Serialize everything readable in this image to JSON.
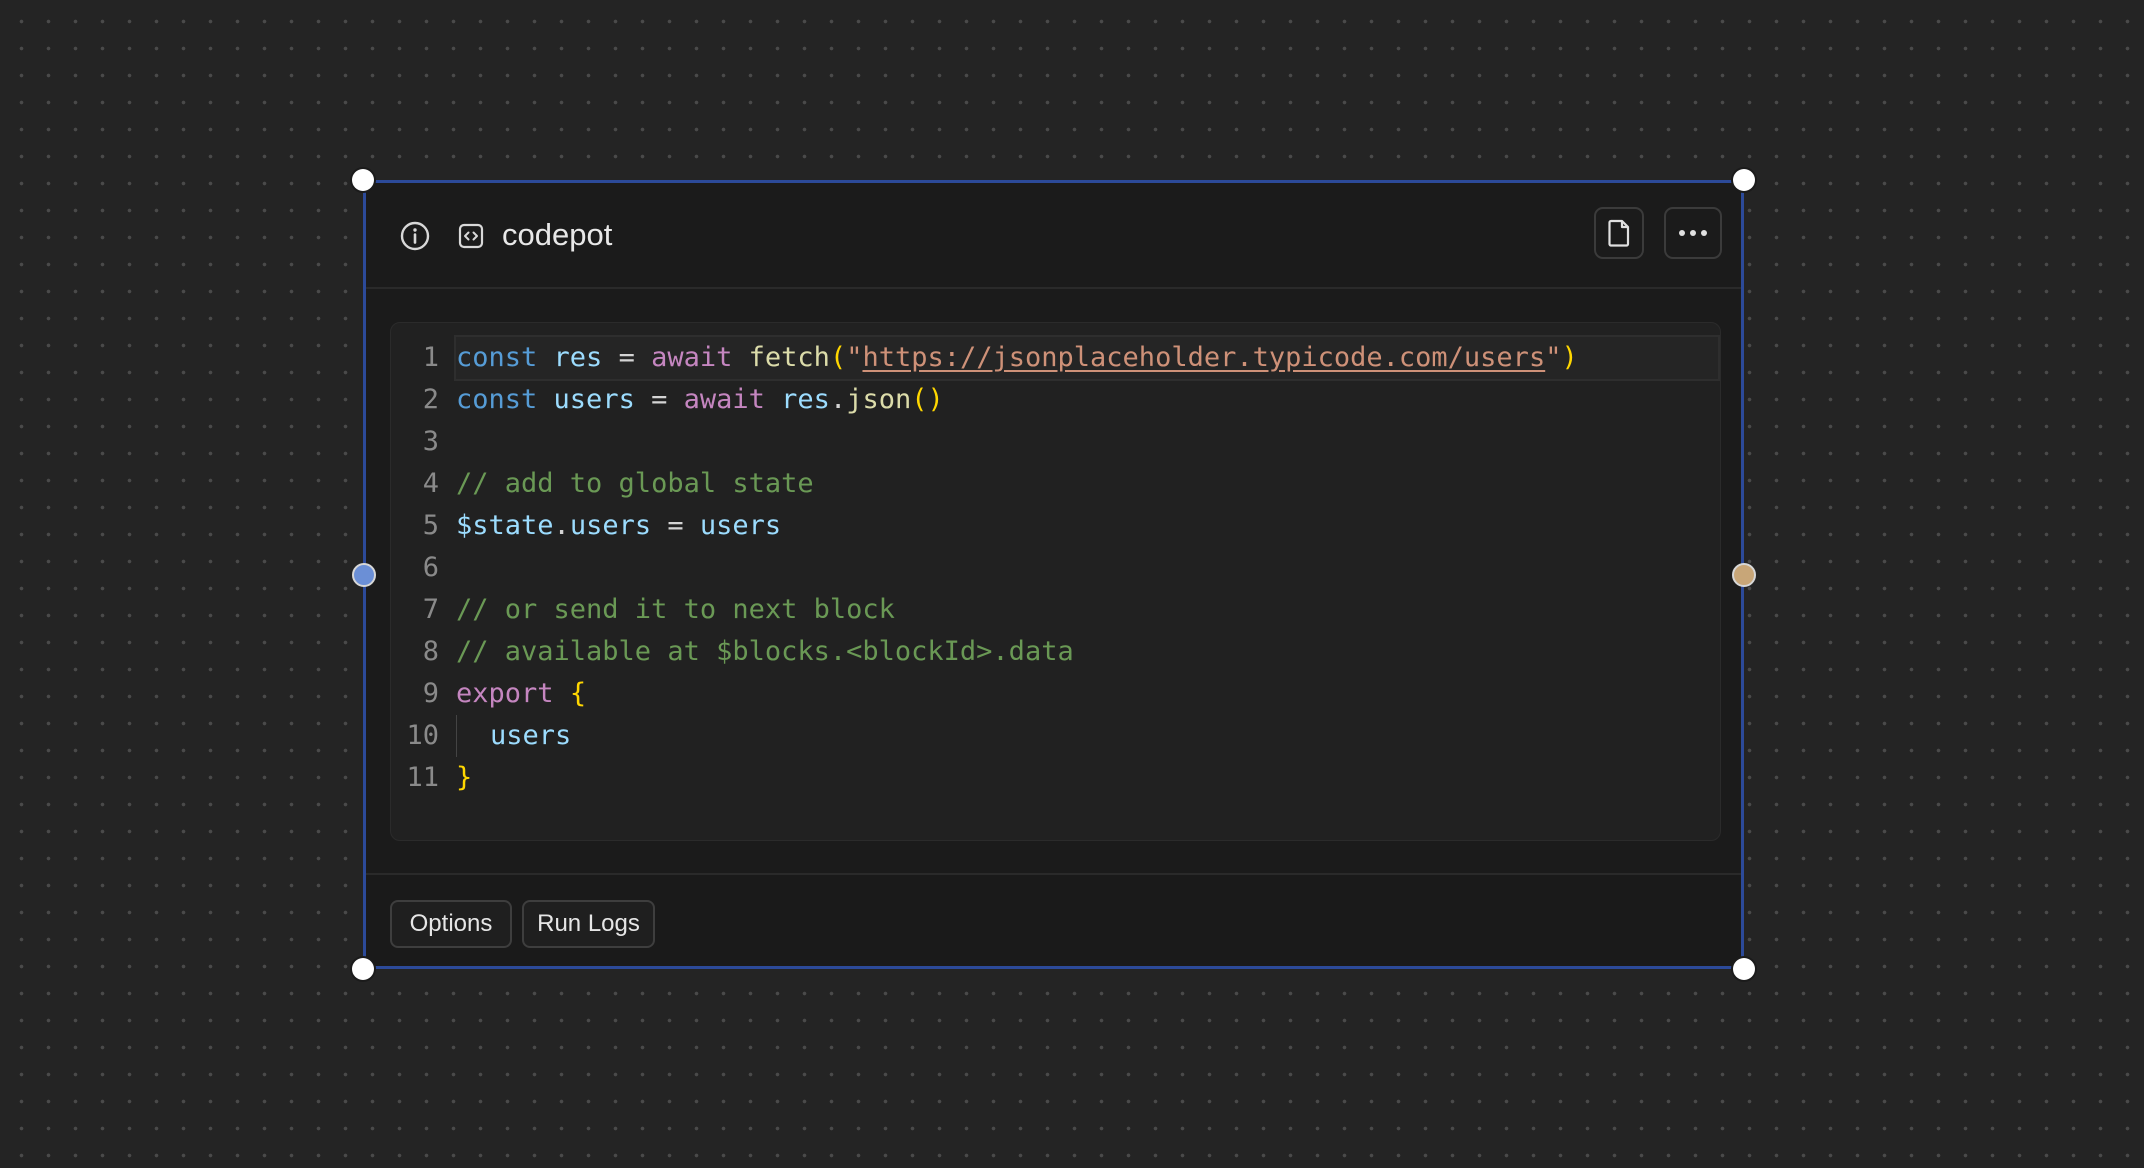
{
  "node": {
    "title": "codepot",
    "icons": {
      "info": "info-circle-icon",
      "code": "code-file-icon",
      "file": "file-icon",
      "more": "more-horizontal-icon",
      "edit": "edit-icon"
    },
    "colors": {
      "selection_border": "#2c4a99",
      "input_port": "#6b8fd6",
      "output_port": "#c8a678"
    }
  },
  "editor": {
    "line_numbers": [
      "1",
      "2",
      "3",
      "4",
      "5",
      "6",
      "7",
      "8",
      "9",
      "10",
      "11"
    ],
    "lines": [
      [
        {
          "t": "const",
          "c": "kw"
        },
        {
          "t": " "
        },
        {
          "t": "res",
          "c": "var"
        },
        {
          "t": " = "
        },
        {
          "t": "await",
          "c": "kw2"
        },
        {
          "t": " "
        },
        {
          "t": "fetch",
          "c": "fn"
        },
        {
          "t": "(",
          "c": "br"
        },
        {
          "t": "\"",
          "c": "str"
        },
        {
          "t": "https://jsonplaceholder.typicode.com/users",
          "c": "url"
        },
        {
          "t": "\"",
          "c": "str"
        },
        {
          "t": ")",
          "c": "br"
        }
      ],
      [
        {
          "t": "const",
          "c": "kw"
        },
        {
          "t": " "
        },
        {
          "t": "users",
          "c": "var"
        },
        {
          "t": " = "
        },
        {
          "t": "await",
          "c": "kw2"
        },
        {
          "t": " "
        },
        {
          "t": "res",
          "c": "var"
        },
        {
          "t": "."
        },
        {
          "t": "json",
          "c": "fn"
        },
        {
          "t": "()",
          "c": "br"
        }
      ],
      [],
      [
        {
          "t": "// add to global state",
          "c": "com"
        }
      ],
      [
        {
          "t": "$state",
          "c": "var"
        },
        {
          "t": "."
        },
        {
          "t": "users",
          "c": "var"
        },
        {
          "t": " = "
        },
        {
          "t": "users",
          "c": "var"
        }
      ],
      [],
      [
        {
          "t": "// or send it to next block",
          "c": "com"
        }
      ],
      [
        {
          "t": "// available at $blocks.<blockId>.data",
          "c": "com"
        }
      ],
      [
        {
          "t": "export",
          "c": "kw2"
        },
        {
          "t": " "
        },
        {
          "t": "{",
          "c": "br"
        }
      ],
      [
        {
          "t": "",
          "c": "indent"
        },
        {
          "t": "users",
          "c": "var"
        }
      ],
      [
        {
          "t": "}",
          "c": "br"
        }
      ]
    ]
  },
  "footer": {
    "tabs": [
      "Options",
      "Run Logs"
    ]
  }
}
